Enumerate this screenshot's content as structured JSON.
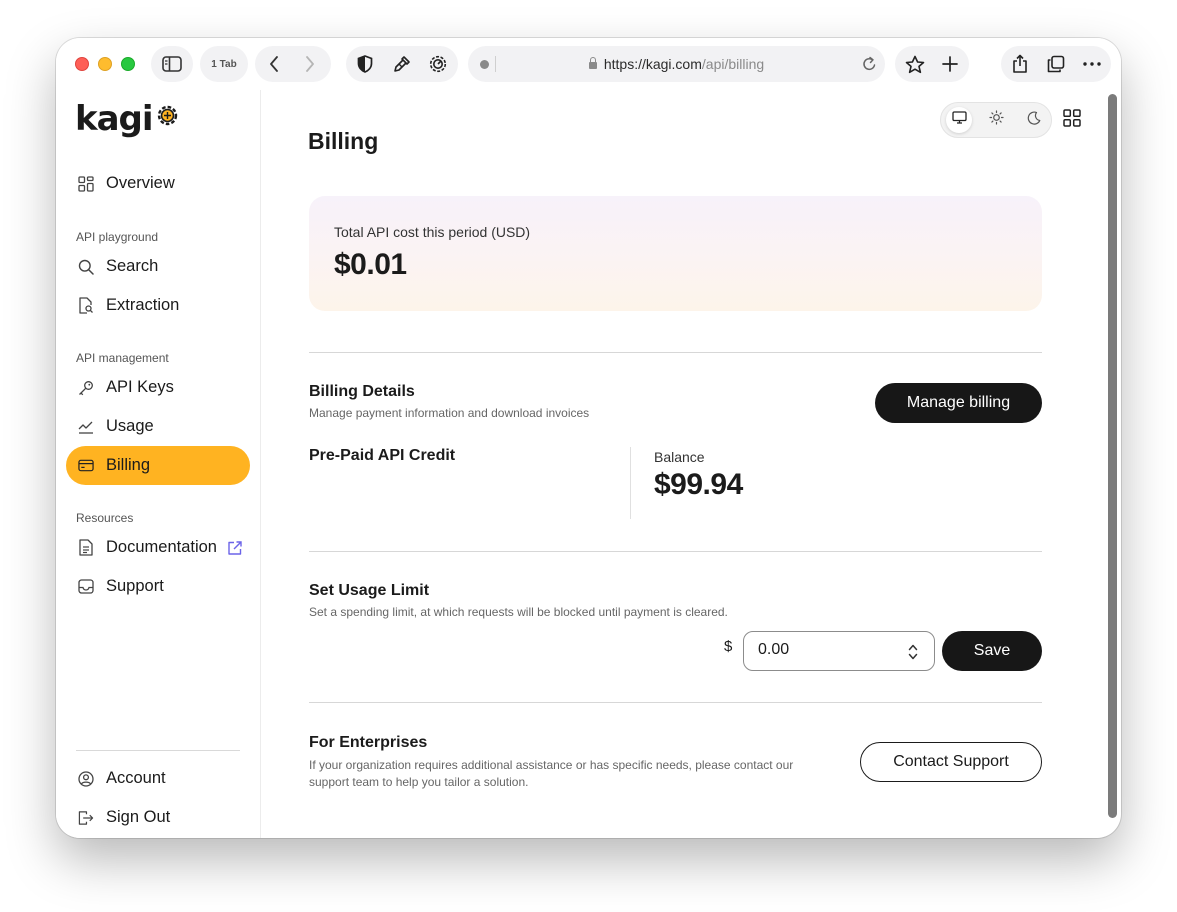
{
  "browser": {
    "tab_count": "1 Tab",
    "url_host": "https://kagi.com",
    "url_path": "/api/billing"
  },
  "sidebar": {
    "logo": "kagi",
    "overview": "Overview",
    "section_playground": "API playground",
    "search": "Search",
    "extraction": "Extraction",
    "section_management": "API management",
    "api_keys": "API Keys",
    "usage": "Usage",
    "billing": "Billing",
    "section_resources": "Resources",
    "documentation": "Documentation",
    "support": "Support",
    "account": "Account",
    "sign_out": "Sign Out"
  },
  "main": {
    "title": "Billing",
    "cost_label": "Total API cost this period (USD)",
    "cost_value": "$0.01",
    "billing_details_title": "Billing Details",
    "billing_details_sub": "Manage payment information and download invoices",
    "manage_billing": "Manage billing",
    "prepaid_title": "Pre-Paid API Credit",
    "balance_label": "Balance",
    "balance_value": "$99.94",
    "usage_limit_title": "Set Usage Limit",
    "usage_limit_sub": "Set a spending limit, at which requests will be blocked until payment is cleared.",
    "currency": "$",
    "limit_value": "0.00",
    "save": "Save",
    "enterprise_title": "For Enterprises",
    "enterprise_sub": "If your organization requires additional assistance or has specific needs, please contact our support team to help you tailor a solution.",
    "contact_support": "Contact Support"
  },
  "theme_selected": "system",
  "colors": {
    "accent": "#ffb321",
    "dark_button": "#171717"
  }
}
